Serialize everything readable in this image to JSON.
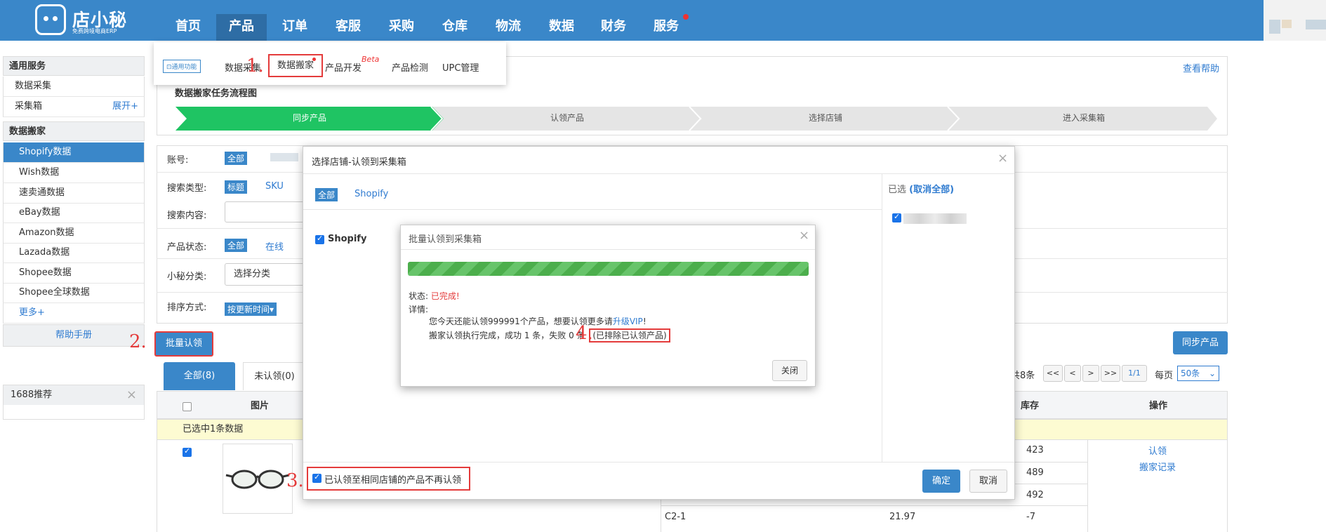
{
  "logo": {
    "text": "店小秘",
    "subtitle": "免费跨境电商ERP"
  },
  "nav": [
    "首页",
    "产品",
    "订单",
    "客服",
    "采购",
    "仓库",
    "物流",
    "数据",
    "财务",
    "服务"
  ],
  "submenu": {
    "badge": "通用功能",
    "items": [
      "数据采集",
      "数据搬家",
      "产品开发",
      "产品检测",
      "UPC管理"
    ],
    "beta": "Beta"
  },
  "sidebar": {
    "section1": "通用服务",
    "items1": [
      "数据采集",
      "采集箱"
    ],
    "expand": "展开+",
    "section2": "数据搬家",
    "items2": [
      "Shopify数据",
      "Wish数据",
      "速卖通数据",
      "eBay数据",
      "Amazon数据",
      "Lazada数据",
      "Shopee数据",
      "Shopee全球数据"
    ],
    "more": "更多+",
    "help": "帮助手册",
    "recommend": "1688推荐"
  },
  "help_link": "查看帮助",
  "flow": {
    "title": "数据搬家任务流程图",
    "steps": [
      "同步产品",
      "认领产品",
      "选择店铺",
      "进入采集箱"
    ]
  },
  "filters": {
    "account": "账号:",
    "account_all": "全部",
    "search_type": "搜索类型:",
    "search_type_title": "标题",
    "search_type_sku": "SKU",
    "search_content": "搜索内容:",
    "status": "产品状态:",
    "status_all": "全部",
    "status_online": "在线",
    "category": "小秘分类:",
    "category_placeholder": "选择分类",
    "sort": "排序方式:",
    "sort_value": "按更新时间▾"
  },
  "actions": {
    "batch_claim": "批量认领",
    "sync": "同步产品"
  },
  "tabs": [
    "全部(8)",
    "未认领(0)"
  ],
  "pagination": {
    "total": "共8条",
    "first": "<<",
    "prev": "<",
    "next": ">",
    "last": ">>",
    "page": "1/1",
    "per_page": "每页",
    "per_page_value": "50条"
  },
  "table": {
    "headers": {
      "image": "图片",
      "stock": "库存",
      "op": "操作"
    },
    "selected_note": "已选中1条数据",
    "stock": [
      "423",
      "489",
      "492",
      "-7"
    ],
    "sku_last": "C2-1",
    "price_last": "21.97",
    "op_links": [
      "认领",
      "搬家记录"
    ]
  },
  "dialog1": {
    "title": "选择店铺-认领到采集箱",
    "tab_all": "全部",
    "tab_shopify": "Shopify",
    "platform": "Shopify",
    "selected_label": "已选",
    "cancel_all": "(取消全部)",
    "footer_check": "已认领至相同店铺的产品不再认领",
    "confirm": "确定",
    "cancel": "取消"
  },
  "dialog2": {
    "title": "批量认领到采集箱",
    "progress": 1.0,
    "status_label": "状态:",
    "status_value": "已完成!",
    "detail_label": "详情:",
    "line1_prefix": "您今天还能认领999991个产品，想要认领更多请",
    "line1_link": "升级VIP",
    "line1_suffix": "!",
    "line2": "搬家认领执行完成，成功 1 条，失败 0 条",
    "line2_note": "(已排除已认领产品)",
    "close": "关闭"
  },
  "markers": [
    "1.",
    "2.",
    "3.",
    "4."
  ],
  "colors": {
    "brand": "#3a87c9",
    "step_active": "#1fc463",
    "marker": "#e43b3b",
    "success": "#4cae4c"
  }
}
